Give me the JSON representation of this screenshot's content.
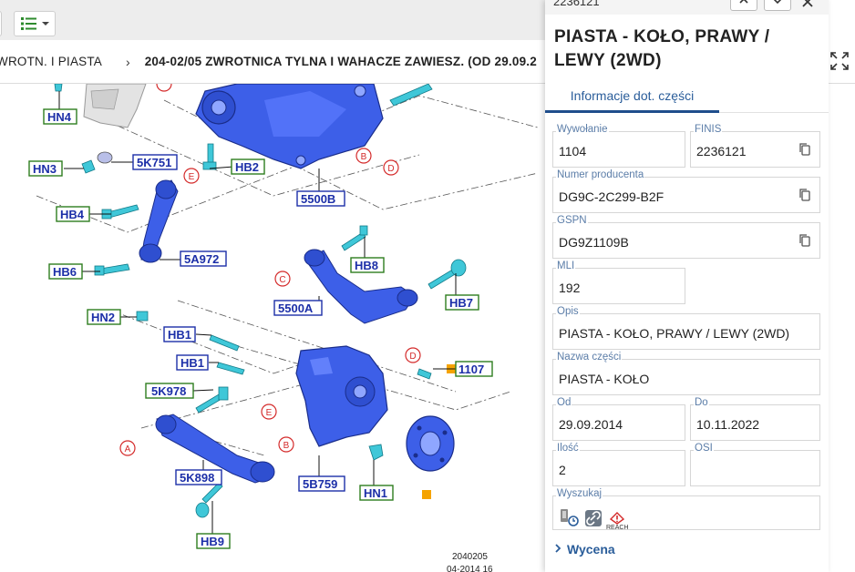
{
  "toolbar": {
    "list_button_icon": "list-icon"
  },
  "breadcrumb": {
    "item1": "WROTN. I PIASTA",
    "separator": "›",
    "item2": "204-02/05 ZWROTNICA TYLNA I WAHACZE ZAWIESZ. (OD 29.09.2"
  },
  "diagram": {
    "labels_blue": [
      "5K751",
      "5500B",
      "5A972",
      "5500A",
      "HB1",
      "HB1",
      "5K978",
      "1107",
      "5K898",
      "5B759"
    ],
    "labels_green": [
      "HN4",
      "HN3",
      "HB2",
      "HB4",
      "HB6",
      "HB8",
      "HB7",
      "HN2",
      "HN1",
      "HB9"
    ],
    "letters": [
      "E",
      "B",
      "D",
      "C",
      "D",
      "E",
      "A",
      "B"
    ],
    "footer_line1": "2040205",
    "footer_line2": "04-2014 16"
  },
  "panel": {
    "id": "2236121",
    "title": "PIASTA - KOŁO, PRAWY / LEWY (2WD)",
    "tab_info": "Informacje dot. części",
    "fields": {
      "wywolanie_label": "Wywołanie",
      "wywolanie": "1104",
      "finis_label": "FINIS",
      "finis": "2236121",
      "numer_label": "Numer producenta",
      "numer": "DG9C-2C299-B2F",
      "gspn_label": "GSPN",
      "gspn": "DG9Z1109B",
      "mli_label": "MLI",
      "mli": "192",
      "opis_label": "Opis",
      "opis": "PIASTA - KOŁO, PRAWY / LEWY (2WD)",
      "nazwa_label": "Nazwa części",
      "nazwa": "PIASTA - KOŁO",
      "od_label": "Od",
      "od": "29.09.2014",
      "do_label": "Do",
      "do": "10.11.2022",
      "ilosc_label": "Ilość",
      "ilosc": "2",
      "osi_label": "OSI",
      "osi": "",
      "wyszukaj_label": "Wyszukaj",
      "reach_label": "REACH"
    },
    "wycena": "Wycena"
  },
  "colors": {
    "accent": "#1f4e8c",
    "label_blue": "#1c2fa8",
    "label_green": "#2e7d1e",
    "part_blue": "#3a5fe0",
    "marker": "#f5a300"
  }
}
